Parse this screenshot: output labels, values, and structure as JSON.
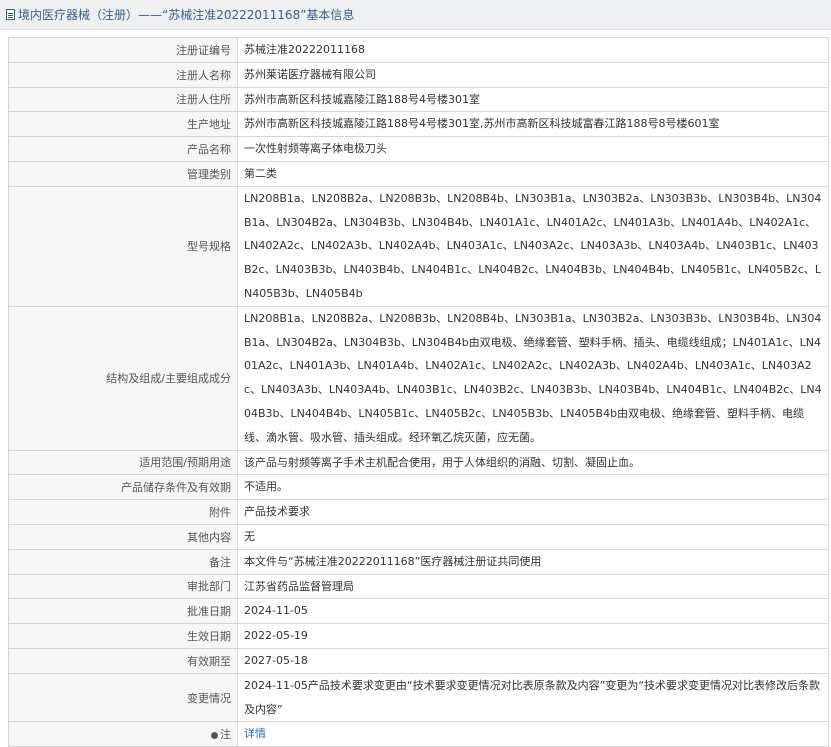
{
  "header": {
    "title": "境内医疗器械（注册）——“苏械注准20222011168”基本信息"
  },
  "rows": [
    {
      "label": "注册证编号",
      "value": "苏械注准20222011168"
    },
    {
      "label": "注册人名称",
      "value": "苏州莱诺医疗器械有限公司"
    },
    {
      "label": "注册人住所",
      "value": "苏州市高新区科技城嘉陵江路188号4号楼301室"
    },
    {
      "label": "生产地址",
      "value": "苏州市高新区科技城嘉陵江路188号4号楼301室,苏州市高新区科技城富春江路188号8号楼601室"
    },
    {
      "label": "产品名称",
      "value": "一次性射频等离子体电极刀头"
    },
    {
      "label": "管理类别",
      "value": "第二类"
    },
    {
      "label": "型号规格",
      "value": "LN208B1a、LN208B2a、LN208B3b、LN208B4b、LN303B1a、LN303B2a、LN303B3b、LN303B4b、LN304B1a、LN304B2a、LN304B3b、LN304B4b、LN401A1c、LN401A2c、LN401A3b、LN401A4b、LN402A1c、LN402A2c、LN402A3b、LN402A4b、LN403A1c、LN403A2c、LN403A3b、LN403A4b、LN403B1c、LN403B2c、LN403B3b、LN403B4b、LN404B1c、LN404B2c、LN404B3b、LN404B4b、LN405B1c、LN405B2c、LN405B3b、LN405B4b"
    },
    {
      "label": "结构及组成/主要组成成分",
      "value": "LN208B1a、LN208B2a、LN208B3b、LN208B4b、LN303B1a、LN303B2a、LN303B3b、LN303B4b、LN304B1a、LN304B2a、LN304B3b、LN304B4b由双电极、绝缘套管、塑料手柄、插头、电缆线组成；LN401A1c、LN401A2c、LN401A3b、LN401A4b、LN402A1c、LN402A2c、LN402A3b、LN402A4b、LN403A1c、LN403A2c、LN403A3b、LN403A4b、LN403B1c、LN403B2c、LN403B3b、LN403B4b、LN404B1c、LN404B2c、LN404B3b、LN404B4b、LN405B1c、LN405B2c、LN405B3b、LN405B4b由双电极、绝缘套管、塑料手柄、电缆线、滴水管、吸水管、插头组成。经环氧乙烷灭菌，应无菌。"
    },
    {
      "label": "适用范围/预期用途",
      "value": "该产品与射频等离子手术主机配合使用，用于人体组织的消融、切割、凝固止血。"
    },
    {
      "label": "产品储存条件及有效期",
      "value": "不适用。"
    },
    {
      "label": "附件",
      "value": "产品技术要求"
    },
    {
      "label": "其他内容",
      "value": "无"
    },
    {
      "label": "备注",
      "value": "本文件与“苏械注准20222011168”医疗器械注册证共同使用"
    },
    {
      "label": "审批部门",
      "value": "江苏省药品监督管理局"
    },
    {
      "label": "批准日期",
      "value": "2024-11-05"
    },
    {
      "label": "生效日期",
      "value": "2022-05-19"
    },
    {
      "label": "有效期至",
      "value": "2027-05-18"
    },
    {
      "label": "变更情况",
      "value": "2024-11-05产品技术要求变更由“技术要求变更情况对比表原条款及内容”变更为“技术要求变更情况对比表修改后条款及内容”"
    }
  ],
  "note_row": {
    "label": "注",
    "link_text": "详情",
    "icon": "note-icon"
  }
}
